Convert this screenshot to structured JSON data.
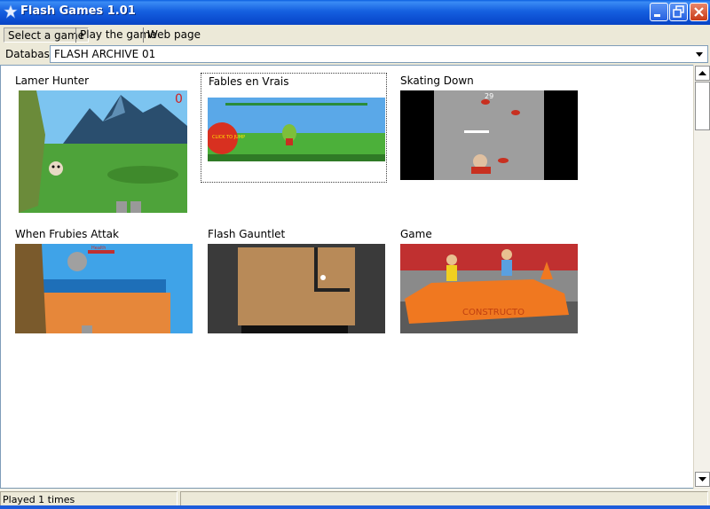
{
  "window": {
    "title": "Flash Games 1.01"
  },
  "menu": {
    "items": [
      {
        "label": "Select a game"
      },
      {
        "label": "Play the game"
      },
      {
        "label": "Web page"
      }
    ]
  },
  "database": {
    "label": "Database",
    "value": "FLASH ARCHIVE 01"
  },
  "games": [
    {
      "title": "Lamer Hunter"
    },
    {
      "title": "Fables en Vrais",
      "selected": true,
      "thumb_text": "CLICK TO JUMP"
    },
    {
      "title": "Skating Down",
      "thumb_text": "29"
    },
    {
      "title": "When Frubies Attak",
      "thumb_text": "Health"
    },
    {
      "title": "Flash Gauntlet"
    },
    {
      "title": "Game",
      "thumb_text": "CONSTRUCTO"
    }
  ],
  "status": {
    "text": "Played 1 times"
  },
  "colors": {
    "titlebar": "#0B4DD0",
    "accent": "#316AC5"
  }
}
